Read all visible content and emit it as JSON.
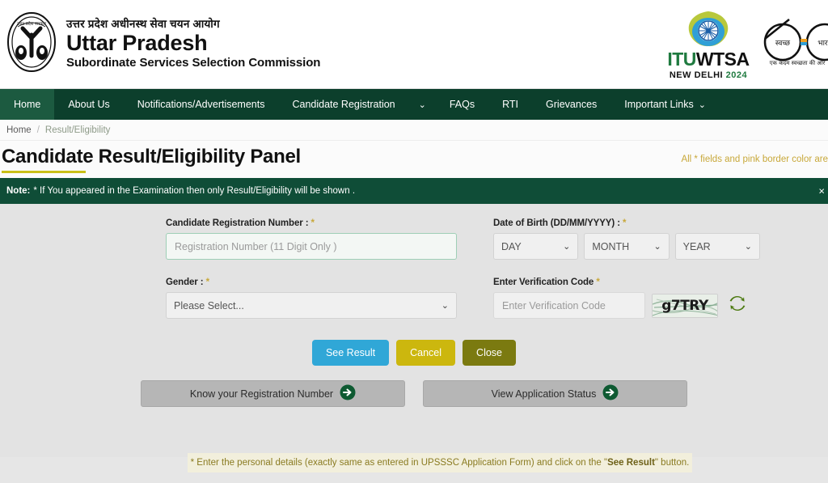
{
  "header": {
    "emblem_icon": "up-government-emblem-icon",
    "hindi_title": "उत्तर प्रदेश अधीनस्थ सेवा चयन आयोग",
    "title_line1": "Uttar Pradesh",
    "title_line2": "Subordinate Services Selection Commission",
    "itu_logo": {
      "name_itu": "ITU",
      "name_wtsa": "WTSA",
      "sub_city": "NEW DELHI",
      "sub_year": "2024",
      "wheel_icon": "ashoka-chakra-icon"
    },
    "swachh_logo": {
      "icon": "swachh-bharat-glasses-icon",
      "lens_left_text": "स्वच्छ",
      "lens_right_text": "भारत",
      "tagline": "एक कदम स्वच्छता की ओर"
    }
  },
  "nav": {
    "items": [
      {
        "label": "Home",
        "active": true,
        "caret": false
      },
      {
        "label": "About Us",
        "active": false,
        "caret": false
      },
      {
        "label": "Notifications/Advertisements",
        "active": false,
        "caret": false
      },
      {
        "label": "Candidate Registration",
        "active": false,
        "caret": false
      },
      {
        "label": "FAQs",
        "active": false,
        "caret": false
      },
      {
        "label": "RTI",
        "active": false,
        "caret": false
      },
      {
        "label": "Grievances",
        "active": false,
        "caret": false
      },
      {
        "label": "Important Links",
        "active": false,
        "caret": true
      }
    ],
    "standalone_caret": "⌄"
  },
  "breadcrumb": {
    "home": "Home",
    "separator": "/",
    "current": "Result/Eligibility"
  },
  "page": {
    "title": "Candidate Result/Eligibility Panel",
    "required_note": "All * fields and pink border color are"
  },
  "note_bar": {
    "prefix": "Note:",
    "text": "* If You appeared in the Examination then only Result/Eligibility will be shown .",
    "close_icon": "close-icon",
    "close_glyph": "×"
  },
  "form": {
    "registration": {
      "label": "Candidate Registration Number : ",
      "star": "*",
      "placeholder": "Registration Number (11 Digit Only )",
      "value": ""
    },
    "dob": {
      "label": "Date of Birth (DD/MM/YYYY) : ",
      "star": "*",
      "day": "DAY",
      "month": "MONTH",
      "year": "YEAR"
    },
    "gender": {
      "label": "Gender : ",
      "star": "*",
      "value": "Please Select..."
    },
    "verification": {
      "label": "Enter Verification Code ",
      "star": "*",
      "placeholder": "Enter Verification Code",
      "value": "",
      "captcha_text": "g7TRY",
      "refresh_icon": "refresh-icon"
    }
  },
  "buttons": {
    "see_result": "See Result",
    "cancel": "Cancel",
    "close": "Close",
    "know_registration": "Know your Registration Number",
    "view_status": "View Application Status",
    "arrow_icon": "arrow-right-circle-icon"
  },
  "footer_note": {
    "part1": "* Enter the personal details (exactly same as entered in UPSSSC Application Form) and click on the \"",
    "emphasis": "See Result",
    "part2": "\" button."
  },
  "colors": {
    "nav_bg": "#0c3f2c",
    "nav_active": "#1c5a40",
    "note_bg": "#0f4d37",
    "accent_yellow": "#c9bf18",
    "primary_blue": "#30a7d7",
    "warn_yellow": "#ccb70e",
    "olive": "#7b7a10",
    "input_border_green": "#9ecfb6",
    "form_bg": "#e3e3e3"
  }
}
